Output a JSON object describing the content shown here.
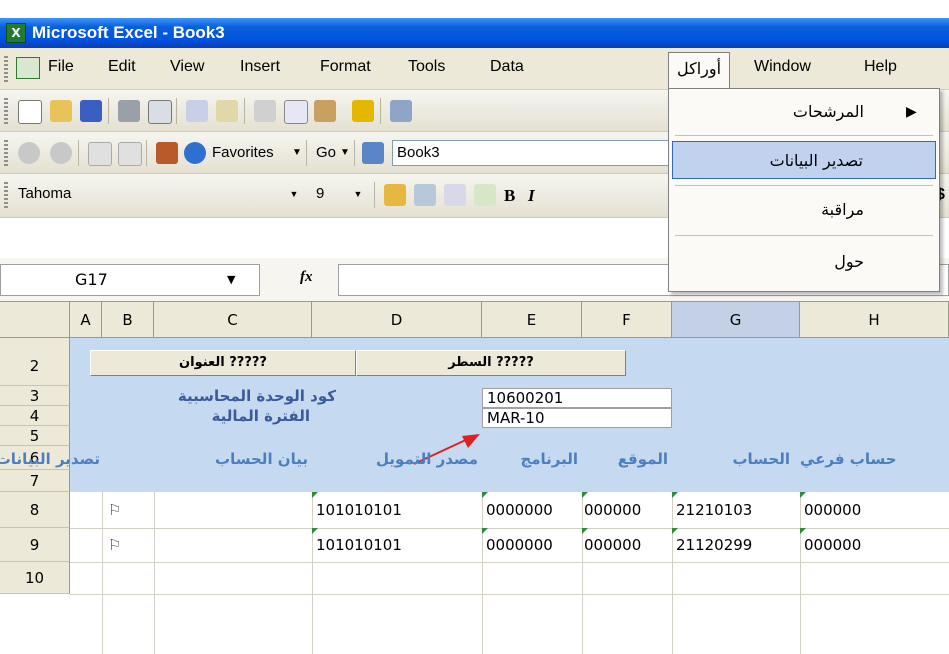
{
  "window": {
    "title": "Microsoft Excel - Book3",
    "icon": "excel-icon"
  },
  "menubar": {
    "items": [
      {
        "label": "File"
      },
      {
        "label": "Edit"
      },
      {
        "label": "View"
      },
      {
        "label": "Insert"
      },
      {
        "label": "Format"
      },
      {
        "label": "Tools"
      },
      {
        "label": "Data"
      },
      {
        "label": "أوراكل"
      },
      {
        "label": "Window"
      },
      {
        "label": "Help"
      }
    ]
  },
  "web_toolbar": {
    "favorites": "Favorites",
    "go": "Go",
    "book_field": "Book3"
  },
  "format_toolbar": {
    "font": "Tahoma",
    "size": "9",
    "bold": "B",
    "italic": "I",
    "currency": "$"
  },
  "formula_bar": {
    "name_box": "G17",
    "fx": "fx",
    "content": ""
  },
  "dropdown": {
    "items": [
      {
        "label": "المرشحات",
        "has_submenu": true
      },
      {
        "label": "تصدير البيانات",
        "highlighted": true
      },
      {
        "label": "مراقبة"
      },
      {
        "label": "حول"
      }
    ]
  },
  "sheet": {
    "columns": [
      "A",
      "B",
      "C",
      "D",
      "E",
      "F",
      "G",
      "H"
    ],
    "selected_column": "G",
    "rows": [
      "2",
      "3",
      "4",
      "5",
      "6",
      "7",
      "8",
      "9",
      "10"
    ],
    "buttons": {
      "title_btn": "العنوان ?????",
      "line_btn": "السطر ?????"
    },
    "labels": {
      "unit_code": "كود الوحدة المحاسبية",
      "fiscal_period": "الفترة المالية",
      "unit_code_value": "10600201",
      "period_value": "MAR-10"
    },
    "headers": {
      "export": "تصدير البيانات",
      "account_desc": "بيان الحساب",
      "funding": "مصدر التمويل",
      "program": "البرنامج",
      "location": "الموقع",
      "account": "الحساب",
      "sub_account": "حساب فرعي"
    },
    "data_rows": [
      {
        "flag": "⚐",
        "d": "101010101",
        "e": "0000000",
        "f": "000000",
        "g": "21210103",
        "h": "000000"
      },
      {
        "flag": "⚐",
        "d": "101010101",
        "e": "0000000",
        "f": "000000",
        "g": "21120299",
        "h": "000000"
      }
    ]
  },
  "colors": {
    "title_bar": "#0054e3",
    "header_band": "#c5d9f1",
    "selected_column": "#c4d0e6",
    "highlight": "#c1d2ee",
    "arrow": "#e02020"
  }
}
